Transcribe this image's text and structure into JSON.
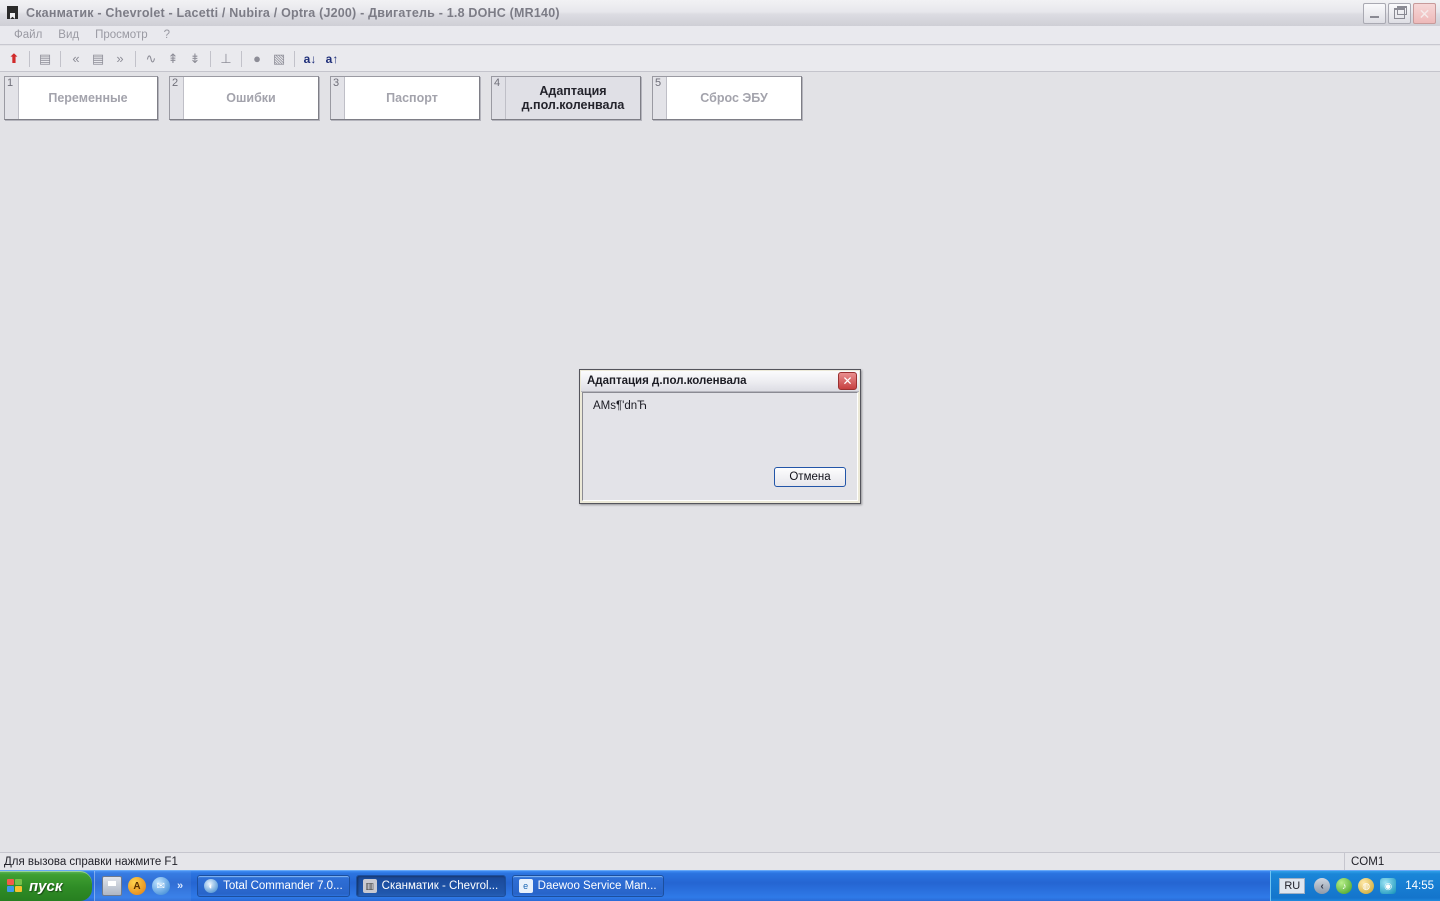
{
  "window": {
    "title": "Сканматик - Chevrolet - Lacetti / Nubira / Optra (J200) - Двигатель - 1.8 DOHC (MR140)",
    "icon": "app-icon",
    "controls": {
      "minimize": "minimize",
      "restore": "restore",
      "close": "close"
    }
  },
  "menu": {
    "items": [
      {
        "label": "Файл"
      },
      {
        "label": "Вид"
      },
      {
        "label": "Просмотр"
      },
      {
        "label": "?"
      }
    ]
  },
  "toolbar": {
    "buttons": [
      {
        "name": "upload-arrow-icon",
        "glyph": "⬆",
        "style": "red"
      },
      {
        "name": "edit-clipboard-icon",
        "glyph": "▤"
      },
      {
        "name": "prev-page-icon",
        "glyph": "«"
      },
      {
        "name": "list-view-icon",
        "glyph": "▤"
      },
      {
        "name": "next-page-icon",
        "glyph": "»"
      },
      {
        "name": "waveform-icon",
        "glyph": "∿"
      },
      {
        "name": "add-item-icon",
        "glyph": "⇞"
      },
      {
        "name": "remove-item-icon",
        "glyph": "⇟"
      },
      {
        "name": "filter-icon",
        "glyph": "⊥"
      },
      {
        "name": "record-icon",
        "glyph": "●"
      },
      {
        "name": "graph-icon",
        "glyph": "▧"
      },
      {
        "name": "sort-descending-icon",
        "glyph": "a↓",
        "style": "blue"
      },
      {
        "name": "sort-ascending-icon",
        "glyph": "a↑",
        "style": "blue"
      }
    ]
  },
  "modes": {
    "buttons": [
      {
        "num": "1",
        "label": "Переменные",
        "active": false
      },
      {
        "num": "2",
        "label": "Ошибки",
        "active": false
      },
      {
        "num": "3",
        "label": "Паспорт",
        "active": false
      },
      {
        "num": "4",
        "label": "Адаптация д.пол.коленвала",
        "label_line1": "Адаптация",
        "label_line2": "д.пол.коленвала",
        "active": true
      },
      {
        "num": "5",
        "label": "Сброс ЭБУ",
        "active": false
      }
    ]
  },
  "dialog": {
    "title": "Адаптация д.пол.коленвала",
    "message": "AMs¶'dnЋ",
    "close_label": "✕",
    "cancel_label": "Отмена"
  },
  "statusbar": {
    "hint": "Для вызова справки нажмите F1",
    "port": "COM1"
  },
  "taskbar": {
    "start_label": "пуск",
    "quicklaunch": [
      {
        "name": "save-icon",
        "glyph": ""
      },
      {
        "name": "acrobat-icon",
        "glyph": "A"
      },
      {
        "name": "messenger-icon",
        "glyph": "✉"
      }
    ],
    "overflow_label": "»",
    "tasks": [
      {
        "label": "Total Commander 7.0...",
        "icon": "total-commander-icon",
        "icon_glyph": "◐",
        "active": false
      },
      {
        "label": "Сканматик - Chevrol...",
        "icon": "scanmatic-icon",
        "icon_glyph": "▥",
        "active": true
      },
      {
        "label": "Daewoo Service Man...",
        "icon": "daewoo-icon",
        "icon_glyph": "e",
        "active": false
      }
    ],
    "tray": {
      "language": "RU",
      "icons": [
        {
          "name": "show-hidden-icons-icon",
          "glyph": "‹"
        },
        {
          "name": "volume-icon",
          "glyph": "♪"
        },
        {
          "name": "disc-icon",
          "glyph": "◍"
        },
        {
          "name": "antivirus-icon",
          "glyph": "◉"
        }
      ],
      "clock": "14:55"
    }
  }
}
